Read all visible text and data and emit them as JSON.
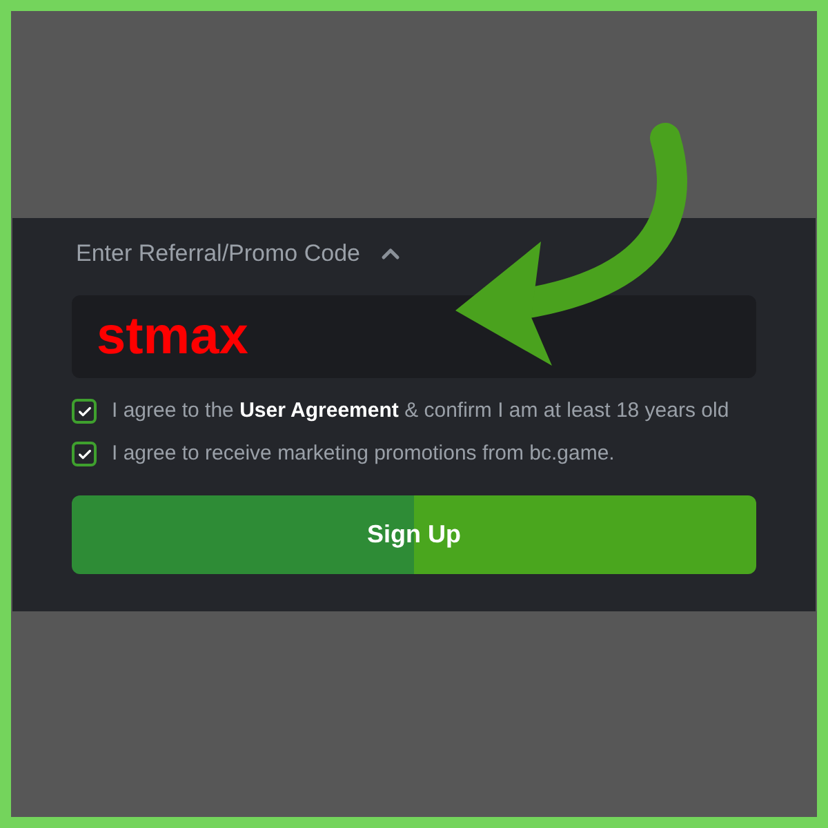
{
  "promo": {
    "label": "Enter Referral/Promo Code",
    "expanded": true,
    "value": "stmax"
  },
  "agreements": [
    {
      "text": "I agree to the **User Agreement** & confirm I am at least 18 years old",
      "checked": true
    },
    {
      "text": "I agree to receive marketing promotions from bc.game.",
      "checked": true
    }
  ],
  "submit": {
    "label": "Sign Up"
  }
}
